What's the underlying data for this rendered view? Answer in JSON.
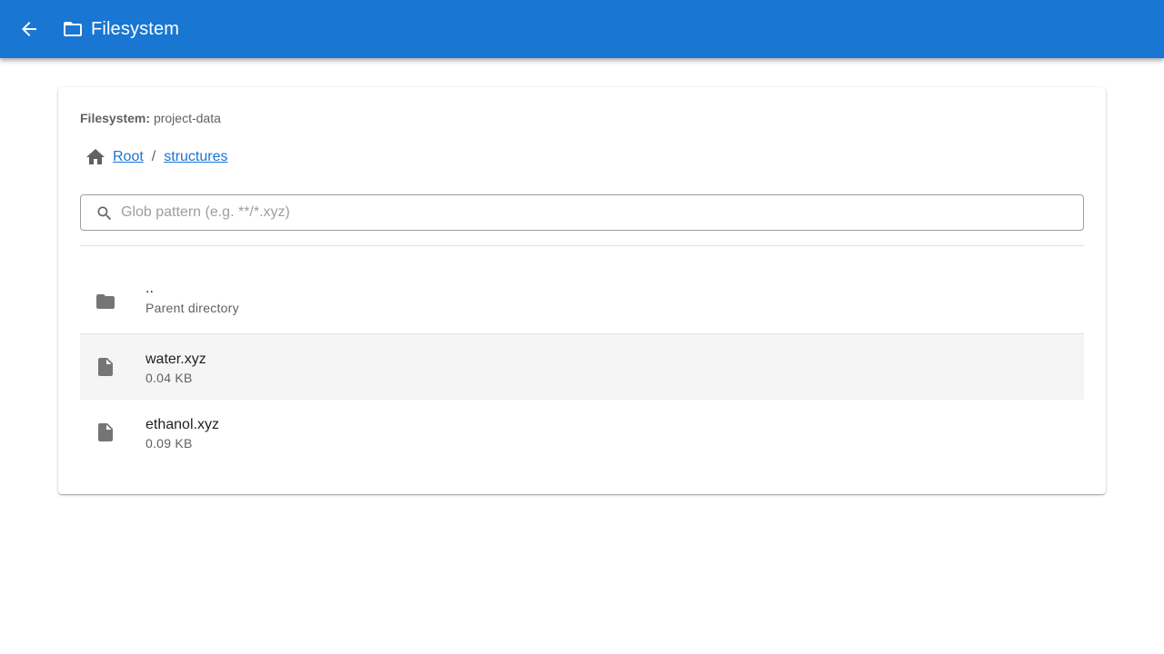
{
  "appbar": {
    "title": "Filesystem",
    "back_icon": "arrow-left-icon",
    "folder_icon": "folder-outline-icon",
    "color": "#1976d2"
  },
  "filesystem": {
    "label": "Filesystem:",
    "name": "project-data"
  },
  "breadcrumb": {
    "home_icon": "home-icon",
    "items": [
      {
        "label": "Root"
      },
      {
        "label": "structures"
      }
    ],
    "separator": "/"
  },
  "search": {
    "placeholder": "Glob pattern (e.g. **/*.xyz)",
    "value": "",
    "icon": "search-icon"
  },
  "files": [
    {
      "name": "..",
      "meta": "Parent directory",
      "icon": "folder-icon"
    },
    {
      "name": "water.xyz",
      "meta": "0.04 KB",
      "icon": "file-icon"
    },
    {
      "name": "ethanol.xyz",
      "meta": "0.09 KB",
      "icon": "file-icon"
    }
  ]
}
